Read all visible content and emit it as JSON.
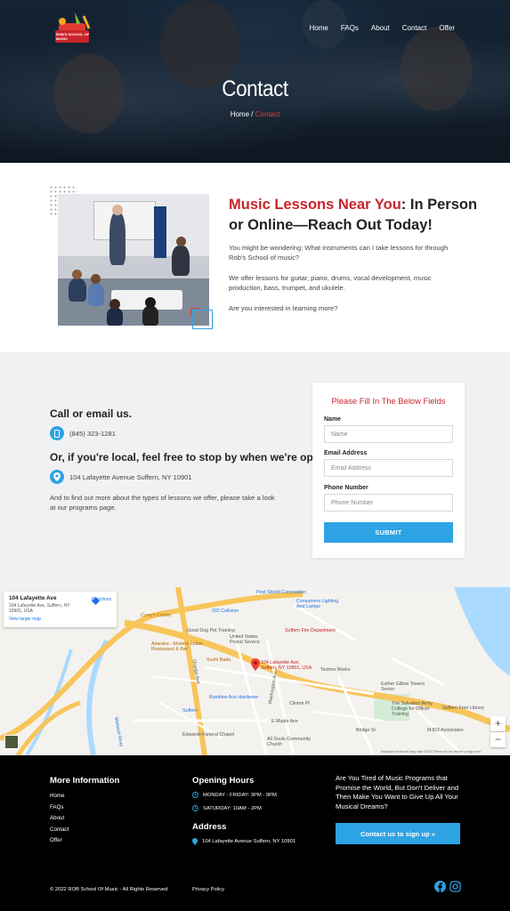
{
  "header": {
    "logo_text": "ROB'S SCHOOL OF MUSIC",
    "nav": [
      "Home",
      "FAQs",
      "About",
      "Contact",
      "Offer"
    ],
    "title": "Contact",
    "breadcrumb": {
      "home": "Home",
      "sep": " / ",
      "current": "Contact"
    }
  },
  "intro": {
    "title_highlight": "Music Lessons Near You",
    "title_rest": ": In Person or Online—Reach Out Today!",
    "p1": "You might be wondering: What instruments can I take lessons for through Rob's School of music?",
    "p2": "We offer lessons for guitar, piano, drums, vocal development, music production, bass, trumpet, and ukulele.",
    "p3": "Are you interested in learning more?"
  },
  "contact": {
    "heading1": "Call or email us.",
    "phone": "(845) 323-1281",
    "heading2": "Or, if you're local, feel free to stop by when we're open.",
    "address": "104 Lafayette Avenue Suffern, NY 10901",
    "note": "And to find out more about the types of lessons we offer, please take a look at our programs page."
  },
  "form": {
    "title": "Please Fill In The Below Fields",
    "name_label": "Name",
    "name_placeholder": "Name",
    "email_label": "Email Address",
    "email_placeholder": "Email Address",
    "phone_label": "Phone Number",
    "phone_placeholder": "Phone Number",
    "submit": "SUBMIT"
  },
  "map": {
    "card_title": "104 Lafayette Ave",
    "card_address": "104 Lafayette Ave, Suffern, NY 10901, USA",
    "card_link": "View larger map",
    "directions": "Directions",
    "pin_label": "104 Lafayette Ave, Suffern, NY 10901, USA",
    "labels": [
      {
        "text": "Pest Shield Corporation",
        "cls": "b"
      },
      {
        "text": "Consumers Lighting And Lamps",
        "cls": "b"
      },
      {
        "text": "202 Collision",
        "cls": "b"
      },
      {
        "text": "Curry's Corner",
        "cls": "o"
      },
      {
        "text": "Good Dog Pet Training",
        "cls": ""
      },
      {
        "text": "United States Postal Service",
        "cls": ""
      },
      {
        "text": "Suffern Fire Department",
        "cls": "r"
      },
      {
        "text": "Adaraka - Modern Indian Restaurant & Bar",
        "cls": "o"
      },
      {
        "text": "Sushi Bada",
        "cls": "o"
      },
      {
        "text": "Techno Works",
        "cls": ""
      },
      {
        "text": "Esther Gillow Towers Senior",
        "cls": ""
      },
      {
        "text": "Rainbow Ace Hardware",
        "cls": "b"
      },
      {
        "text": "Suffern",
        "cls": "b"
      },
      {
        "text": "The Salvation Army College for Officer Training",
        "cls": ""
      },
      {
        "text": "Suffern Free Library",
        "cls": ""
      },
      {
        "text": "MJD3 Associates",
        "cls": ""
      },
      {
        "text": "Edwards Funeral Chapel",
        "cls": ""
      },
      {
        "text": "All Souls Community Church",
        "cls": ""
      },
      {
        "text": "Orange Ave",
        "cls": ""
      },
      {
        "text": "Washington Ave",
        "cls": ""
      },
      {
        "text": "Clinton Pl",
        "cls": ""
      },
      {
        "text": "E Maple Ave",
        "cls": ""
      },
      {
        "text": "Bridge St",
        "cls": ""
      },
      {
        "text": "Mahwah River",
        "cls": "b"
      },
      {
        "text": "Keyboard shortcuts   Map data ©2022   Terms of Use   Report a map error",
        "cls": ""
      }
    ],
    "zoom_in": "+",
    "zoom_out": "−"
  },
  "footer": {
    "more_title": "More Information",
    "links": [
      "Home",
      "FAQs",
      "About",
      "Contact",
      "Offer"
    ],
    "hours_title": "Opening Hours",
    "hours": [
      "MONDAY - FRIDAY: 3PM - 9PM",
      "SATURDAY: 10AM - 2PM"
    ],
    "address_title": "Address",
    "address": "104 Lafayette Avenue Suffern, NY 10901",
    "cta_text": "Are You Tired of Music Programs that Promise the World, But Don't Deliver and Then Make You Want to Give Up All Your Musical Dreams?",
    "cta_button": "Contact us to sign up  »",
    "copyright": "© 2022 ROB School Of Music - All Rights Reserved",
    "privacy": "Privacy Policy"
  },
  "colors": {
    "accent": "#2ea3e3",
    "brand_red": "#c8242b",
    "footer_bg": "#000000",
    "section_bg": "#f0f1f2"
  },
  "icons": [
    "phone-icon",
    "location-icon",
    "clock-icon",
    "map-pin-icon",
    "facebook-icon",
    "instagram-icon",
    "chevron-right-icon"
  ]
}
